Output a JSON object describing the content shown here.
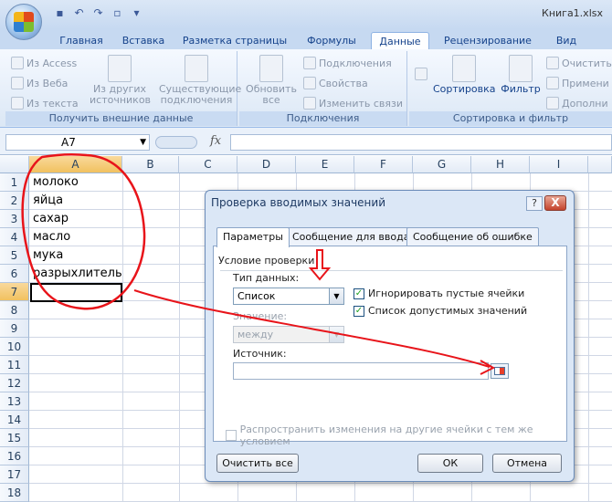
{
  "window": {
    "title": "Книга1.xlsx"
  },
  "tabs": [
    "Главная",
    "Вставка",
    "Разметка страницы",
    "Формулы",
    "Данные",
    "Рецензирование",
    "Вид"
  ],
  "active_tab": "Данные",
  "ribbon": {
    "external_data": {
      "label": "Получить внешние данные",
      "from_access": "Из Access",
      "from_web": "Из Веба",
      "from_text": "Из текста",
      "from_other": "Из других источников",
      "existing": "Существующие подключения"
    },
    "connections": {
      "label": "Подключения",
      "refresh_all": "Обновить все",
      "connections": "Подключения",
      "properties": "Свойства",
      "edit_links": "Изменить связи"
    },
    "sort_filter": {
      "label": "Сортировка и фильтр",
      "sort": "Сортировка",
      "filter": "Фильтр",
      "clear": "Очистить",
      "reapply": "Примени",
      "advanced": "Дополни"
    }
  },
  "formula_bar": {
    "name_box": "A7",
    "fx": "fx",
    "value": ""
  },
  "grid": {
    "columns": [
      "A",
      "B",
      "C",
      "D",
      "E",
      "F",
      "G",
      "H",
      "I"
    ],
    "rows": [
      "1",
      "2",
      "3",
      "4",
      "5",
      "6",
      "7",
      "8",
      "9",
      "10",
      "11",
      "12",
      "13",
      "14",
      "15",
      "16",
      "17",
      "18"
    ],
    "cells_a": [
      "молоко",
      "яйца",
      "сахар",
      "масло",
      "мука",
      "разрыхлитель"
    ],
    "selected_cell": "A7"
  },
  "dialog": {
    "title": "Проверка вводимых значений",
    "help": "?",
    "close": "X",
    "tabs": [
      "Параметры",
      "Сообщение для ввода",
      "Сообщение об ошибке"
    ],
    "section": "Условие проверки",
    "data_type_label": "Тип данных:",
    "data_type_value": "Список",
    "ignore_blank": "Игнорировать пустые ячейки",
    "in_cell_dropdown": "Список допустимых значений",
    "value_label": "Значение:",
    "value_value": "между",
    "source_label": "Источник:",
    "source_value": "",
    "apply_all": "Распространить изменения на другие ячейки с тем же условием",
    "clear_all": "Очистить все",
    "ok": "ОК",
    "cancel": "Отмена"
  },
  "colors": {
    "annotation": "#e8141a",
    "ribbon": "#dbe7f5",
    "selection": "#f1c15f"
  }
}
